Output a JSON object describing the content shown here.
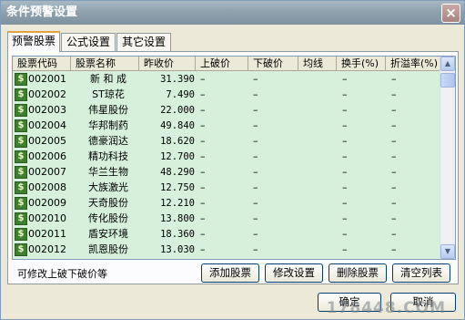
{
  "window": {
    "title": "条件预警设置"
  },
  "tabs": [
    {
      "label": "预警股票"
    },
    {
      "label": "公式设置"
    },
    {
      "label": "其它设置"
    }
  ],
  "table": {
    "headers": [
      "股票代码",
      "股票名称",
      "昨收价",
      "上破价",
      "下破价",
      "均线",
      "换手(%)",
      "折溢率(%)"
    ],
    "rows": [
      {
        "code": "002001",
        "name": "新 和 成",
        "prev": "31.390",
        "up": "–",
        "down": "–",
        "ma": "",
        "turn": "–",
        "prem": "–"
      },
      {
        "code": "002002",
        "name": "ST琼花",
        "prev": "7.490",
        "up": "–",
        "down": "–",
        "ma": "",
        "turn": "–",
        "prem": "–"
      },
      {
        "code": "002003",
        "name": "伟星股份",
        "prev": "22.000",
        "up": "–",
        "down": "–",
        "ma": "",
        "turn": "–",
        "prem": "–"
      },
      {
        "code": "002004",
        "name": "华邦制药",
        "prev": "49.840",
        "up": "–",
        "down": "–",
        "ma": "",
        "turn": "–",
        "prem": "–"
      },
      {
        "code": "002005",
        "name": "德豪润达",
        "prev": "18.620",
        "up": "–",
        "down": "–",
        "ma": "",
        "turn": "–",
        "prem": "–"
      },
      {
        "code": "002006",
        "name": "精功科技",
        "prev": "12.700",
        "up": "–",
        "down": "–",
        "ma": "",
        "turn": "–",
        "prem": "–"
      },
      {
        "code": "002007",
        "name": "华兰生物",
        "prev": "48.290",
        "up": "–",
        "down": "–",
        "ma": "",
        "turn": "–",
        "prem": "–"
      },
      {
        "code": "002008",
        "name": "大族激光",
        "prev": "12.750",
        "up": "–",
        "down": "–",
        "ma": "",
        "turn": "–",
        "prem": "–"
      },
      {
        "code": "002009",
        "name": "天奇股份",
        "prev": "12.210",
        "up": "–",
        "down": "–",
        "ma": "",
        "turn": "–",
        "prem": "–"
      },
      {
        "code": "002010",
        "name": "传化股份",
        "prev": "13.800",
        "up": "–",
        "down": "–",
        "ma": "",
        "turn": "–",
        "prem": "–"
      },
      {
        "code": "002011",
        "name": "盾安环境",
        "prev": "18.360",
        "up": "–",
        "down": "–",
        "ma": "",
        "turn": "–",
        "prem": "–"
      },
      {
        "code": "002012",
        "name": "凯恩股份",
        "prev": "13.030",
        "up": "–",
        "down": "–",
        "ma": "",
        "turn": "–",
        "prem": "–"
      }
    ]
  },
  "hint": "可修改上破下破价等",
  "buttons": {
    "add": "添加股票",
    "edit": "修改设置",
    "delete": "删除股票",
    "clear": "清空列表",
    "ok": "确定",
    "cancel": "取消"
  },
  "icons": {
    "close": "close-icon",
    "row": "dollar-icon"
  },
  "colors": {
    "grid_bg": "#d6f0dc",
    "title_bg": "#8fa2ae",
    "tab_accent": "#e7a13c"
  },
  "watermark": "178448.COM"
}
